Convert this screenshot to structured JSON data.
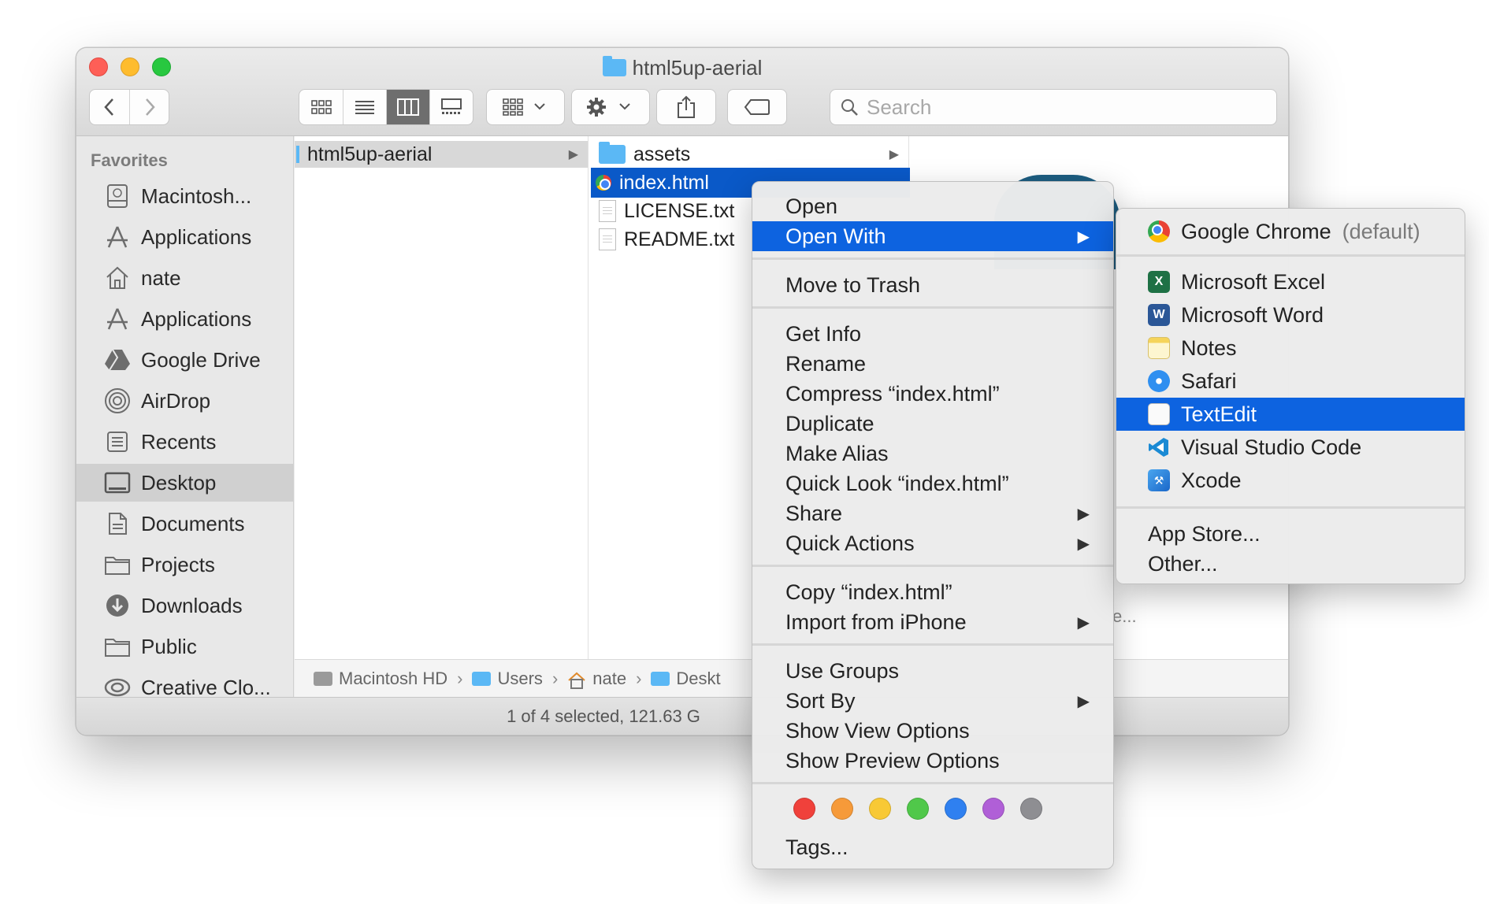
{
  "window": {
    "title": "html5up-aerial"
  },
  "search": {
    "placeholder": "Search"
  },
  "sidebar": {
    "heading": "Favorites",
    "items": [
      {
        "label": "Macintosh...",
        "icon": "hard-drive-icon"
      },
      {
        "label": "Applications",
        "icon": "applications-icon"
      },
      {
        "label": "nate",
        "icon": "home-icon"
      },
      {
        "label": "Applications",
        "icon": "applications-icon"
      },
      {
        "label": "Google Drive",
        "icon": "google-drive-icon"
      },
      {
        "label": "AirDrop",
        "icon": "airdrop-icon"
      },
      {
        "label": "Recents",
        "icon": "recents-icon"
      },
      {
        "label": "Desktop",
        "icon": "desktop-icon",
        "active": true
      },
      {
        "label": "Documents",
        "icon": "documents-icon"
      },
      {
        "label": "Projects",
        "icon": "folder-icon"
      },
      {
        "label": "Downloads",
        "icon": "downloads-icon"
      },
      {
        "label": "Public",
        "icon": "folder-icon"
      },
      {
        "label": "Creative Clo...",
        "icon": "creative-cloud-icon"
      }
    ]
  },
  "columns": {
    "col1": [
      {
        "label": "html5up-aerial",
        "kind": "folder",
        "selected": true
      }
    ],
    "col2": [
      {
        "label": "assets",
        "kind": "folder"
      },
      {
        "label": "index.html",
        "kind": "html",
        "selected": true
      },
      {
        "label": "LICENSE.txt",
        "kind": "text"
      },
      {
        "label": "README.txt",
        "kind": "text"
      }
    ]
  },
  "preview": {
    "truncated_text": "e..."
  },
  "pathbar": {
    "items": [
      "Macintosh HD",
      "Users",
      "nate",
      "Deskt"
    ]
  },
  "status": {
    "text": "1 of 4 selected, 121.63 G"
  },
  "context_menu": {
    "items": [
      {
        "label": "Open"
      },
      {
        "label": "Open With",
        "submenu": true,
        "highlighted": true
      },
      {
        "label": "Move to Trash"
      },
      {
        "label": "Get Info"
      },
      {
        "label": "Rename"
      },
      {
        "label": "Compress “index.html”"
      },
      {
        "label": "Duplicate"
      },
      {
        "label": "Make Alias"
      },
      {
        "label": "Quick Look “index.html”"
      },
      {
        "label": "Share",
        "submenu": true
      },
      {
        "label": "Quick Actions",
        "submenu": true
      },
      {
        "label": "Copy “index.html”"
      },
      {
        "label": "Import from iPhone",
        "submenu": true
      },
      {
        "label": "Use Groups"
      },
      {
        "label": "Sort By",
        "submenu": true
      },
      {
        "label": "Show View Options"
      },
      {
        "label": "Show Preview Options"
      }
    ],
    "tag_colors": [
      "#f0413b",
      "#f69a39",
      "#f8c935",
      "#50c84a",
      "#2f80f0",
      "#b05fd7",
      "#8e8e92"
    ],
    "tags_label": "Tags..."
  },
  "open_with_menu": {
    "default_app": {
      "label": "Google Chrome",
      "suffix": "(default)"
    },
    "apps": [
      {
        "label": "Microsoft Excel",
        "icon": "excel-icon"
      },
      {
        "label": "Microsoft Word",
        "icon": "word-icon"
      },
      {
        "label": "Notes",
        "icon": "notes-icon"
      },
      {
        "label": "Safari",
        "icon": "safari-icon"
      },
      {
        "label": "TextEdit",
        "icon": "textedit-icon",
        "highlighted": true
      },
      {
        "label": "Visual Studio Code",
        "icon": "vscode-icon"
      },
      {
        "label": "Xcode",
        "icon": "xcode-icon"
      }
    ],
    "extras": [
      {
        "label": "App Store..."
      },
      {
        "label": "Other..."
      }
    ]
  },
  "colors": {
    "selection_blue": "#0d63e0",
    "traffic_red": "#fe5f57",
    "traffic_yellow": "#febc2e",
    "traffic_green": "#28c840"
  }
}
